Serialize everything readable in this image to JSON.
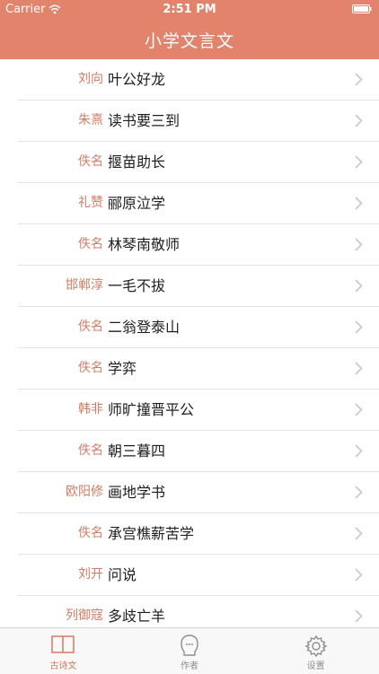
{
  "status_bar": {
    "carrier": "Carrier",
    "time": "2:51 PM"
  },
  "nav": {
    "title": "小学文言文"
  },
  "list": [
    {
      "author": "刘向",
      "title": "叶公好龙"
    },
    {
      "author": "朱熹",
      "title": "读书要三到"
    },
    {
      "author": "佚名",
      "title": "揠苗助长"
    },
    {
      "author": "礼赞",
      "title": "郦原泣学"
    },
    {
      "author": "佚名",
      "title": "林琴南敬师"
    },
    {
      "author": "邯郸淳",
      "title": "一毛不拔"
    },
    {
      "author": "佚名",
      "title": "二翁登泰山"
    },
    {
      "author": "佚名",
      "title": "学弈"
    },
    {
      "author": "韩非",
      "title": "师旷撞晋平公"
    },
    {
      "author": "佚名",
      "title": "朝三暮四"
    },
    {
      "author": "欧阳修",
      "title": "画地学书"
    },
    {
      "author": "佚名",
      "title": "承宫樵薪苦学"
    },
    {
      "author": "刘开",
      "title": "问说"
    },
    {
      "author": "列御寇",
      "title": "多歧亡羊"
    }
  ],
  "tabbar": {
    "tabs": [
      {
        "label": "古诗文",
        "icon": "book-icon",
        "active": true
      },
      {
        "label": "作者",
        "icon": "person-icon",
        "active": false
      },
      {
        "label": "设置",
        "icon": "gear-icon",
        "active": false
      }
    ]
  },
  "colors": {
    "accent": "#e2836b",
    "author_text": "#d17c64",
    "active_tab": "#d9785d",
    "inactive_tab": "#8e8e8e"
  }
}
